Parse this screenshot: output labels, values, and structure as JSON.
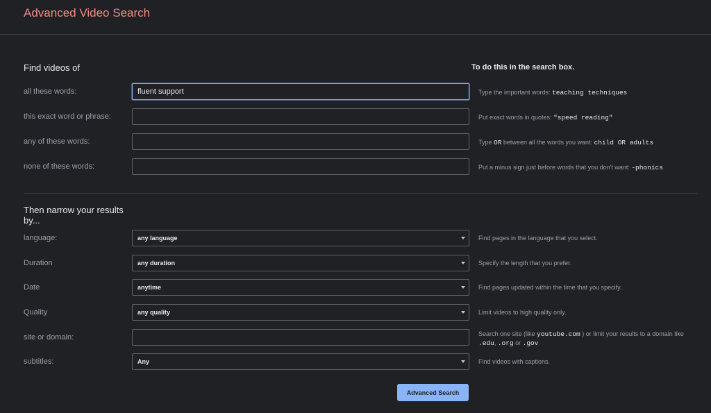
{
  "header": {
    "title": "Advanced Video Search"
  },
  "find": {
    "heading": "Find videos of",
    "right_heading": "To do this in the search box.",
    "all_label": "all these words:",
    "all_value": "fluent support",
    "all_hint": "Type the important words: ",
    "all_hint_code": "teaching techniques",
    "exact_label": "this exact word or phrase:",
    "exact_hint": "Put exact words in quotes: ",
    "exact_hint_code": "\"speed reading\"",
    "any_label": "any of these words:",
    "any_hint_a": "Type ",
    "any_hint_or": "OR",
    "any_hint_b": " between all the words you want: ",
    "any_hint_code": "child OR adults",
    "none_label": "none of these words:",
    "none_hint": "Put a minus sign just before words that you don't want: ",
    "none_hint_code": "-phonics"
  },
  "narrow": {
    "heading_line1": "Then narrow your results",
    "heading_line2": "by...",
    "language_label": "language:",
    "language_value": "any language",
    "language_hint": "Find pages in the language that you select.",
    "duration_label": "Duration",
    "duration_value": "any duration",
    "duration_hint": "Specify the length that you prefer.",
    "date_label": "Date",
    "date_value": "anytime",
    "date_hint": "Find pages updated within the time that you specify.",
    "quality_label": "Quality",
    "quality_value": "any quality",
    "quality_hint": "Limit videos to high quality only.",
    "site_label": "site or domain:",
    "site_hint_a": "Search one site (like ",
    "site_hint_code1": "youtube.com",
    "site_hint_b": " ) or limit your results to a domain like",
    "site_hint_code2": ".edu",
    "site_hint_c": ", ",
    "site_hint_code3": ".org",
    "site_hint_d": " or ",
    "site_hint_code4": ".gov",
    "subtitles_label": "subtitles:",
    "subtitles_value": "Any",
    "subtitles_hint": "Find videos with captions."
  },
  "submit_label": "Advanced Search"
}
